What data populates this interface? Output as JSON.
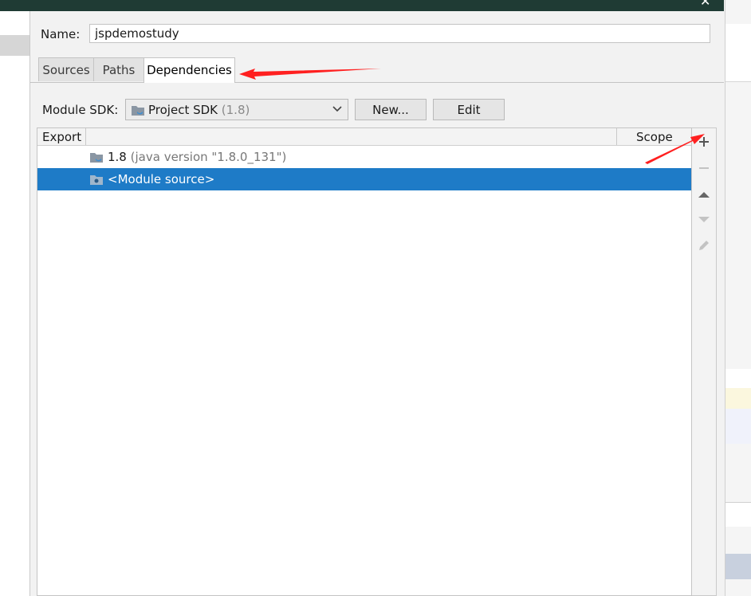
{
  "dialog": {
    "name_label": "Name:",
    "name_value": "jspdemostudy"
  },
  "tabs": [
    {
      "label": "Sources"
    },
    {
      "label": "Paths"
    },
    {
      "label": "Dependencies"
    }
  ],
  "sdk": {
    "label": "Module SDK:",
    "selected_name": "Project SDK",
    "selected_version": "(1.8)",
    "new_button": "New...",
    "edit_button": "Edit"
  },
  "table": {
    "col_export": "Export",
    "col_scope": "Scope",
    "rows": [
      {
        "name": "1.8",
        "detail": "(java version \"1.8.0_131\")",
        "icon": "jdk-folder-icon",
        "selected": false
      },
      {
        "name": "<Module source>",
        "detail": "",
        "icon": "module-source-folder-icon",
        "selected": true
      }
    ]
  },
  "tools": [
    {
      "icon": "plus-icon"
    },
    {
      "icon": "minus-icon"
    },
    {
      "icon": "move-up-icon"
    },
    {
      "icon": "move-down-icon"
    },
    {
      "icon": "edit-pencil-icon"
    }
  ],
  "colors": {
    "selection": "#1e7bc7",
    "annotation_arrow": "#ff2020",
    "titlebar": "#1f3b34"
  }
}
